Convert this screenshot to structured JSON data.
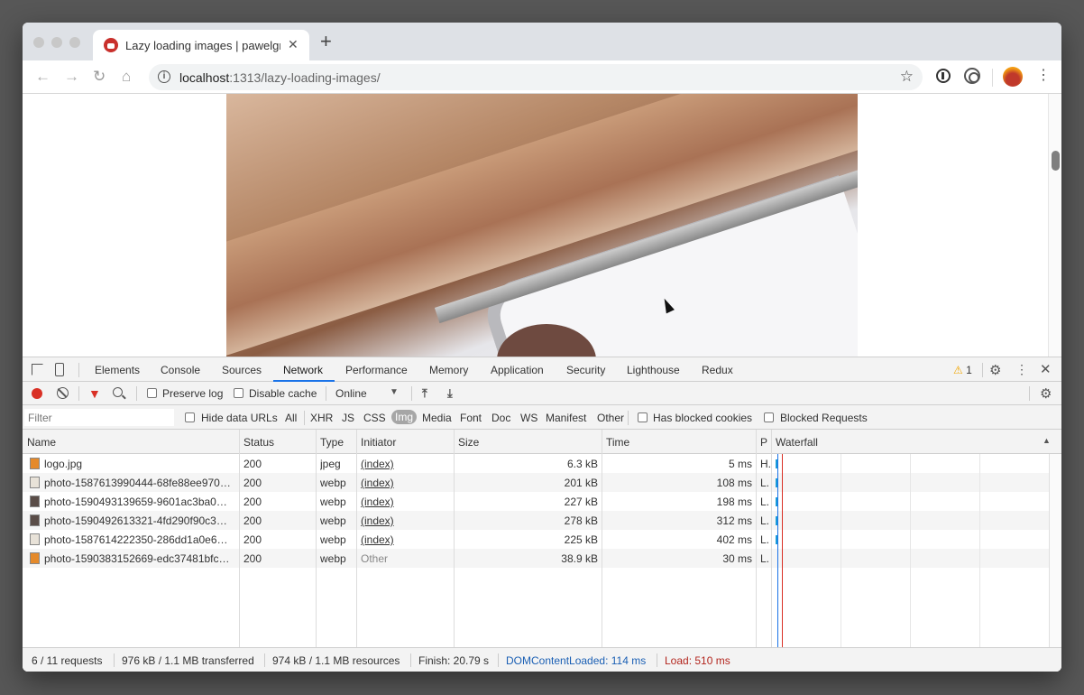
{
  "browser": {
    "tab_title": "Lazy loading images | pawelgrzybek.com",
    "tab_close": "✕",
    "new_tab": "+",
    "url_host": "localhost",
    "url_path": ":1313/lazy-loading-images/",
    "info_glyph": "i",
    "star_glyph": "☆",
    "back_glyph": "←",
    "forward_glyph": "→",
    "reload_glyph": "↻",
    "home_glyph": "⌂",
    "menu_glyph": "⋮"
  },
  "devtools": {
    "tabs": [
      "Elements",
      "Console",
      "Sources",
      "Network",
      "Performance",
      "Memory",
      "Application",
      "Security",
      "Lighthouse",
      "Redux"
    ],
    "active_tab": "Network",
    "warnings": "1",
    "warning_glyph": "⚠",
    "gear_glyph": "⚙",
    "more_glyph": "⋮",
    "close_glyph": "✕",
    "toolbar": {
      "preserve_log": "Preserve log",
      "disable_cache": "Disable cache",
      "throttling": "Online",
      "caret": "▼",
      "upload_glyph": "⤒",
      "download_glyph": "⤓",
      "filter_glyph": "▼"
    },
    "filter": {
      "placeholder": "Filter",
      "hide_data_urls": "Hide data URLs",
      "types": [
        "All",
        "XHR",
        "JS",
        "CSS",
        "Img",
        "Media",
        "Font",
        "Doc",
        "WS",
        "Manifest",
        "Other"
      ],
      "active_type": "Img",
      "has_blocked_cookies": "Has blocked cookies",
      "blocked_requests": "Blocked Requests"
    },
    "columns": {
      "name": "Name",
      "status": "Status",
      "type": "Type",
      "initiator": "Initiator",
      "size": "Size",
      "time": "Time",
      "priority": "P",
      "waterfall": "Waterfall",
      "sort_glyph": "▲"
    },
    "requests": [
      {
        "name": "logo.jpg",
        "status": "200",
        "type": "jpeg",
        "initiator": "(index)",
        "size": "6.3 kB",
        "time": "5 ms",
        "priority": "H."
      },
      {
        "name": "photo-1587613990444-68fe88ee970…",
        "status": "200",
        "type": "webp",
        "initiator": "(index)",
        "size": "201 kB",
        "time": "108 ms",
        "priority": "L."
      },
      {
        "name": "photo-1590493139659-9601ac3ba0…",
        "status": "200",
        "type": "webp",
        "initiator": "(index)",
        "size": "227 kB",
        "time": "198 ms",
        "priority": "L."
      },
      {
        "name": "photo-1590492613321-4fd290f90c3…",
        "status": "200",
        "type": "webp",
        "initiator": "(index)",
        "size": "278 kB",
        "time": "312 ms",
        "priority": "L."
      },
      {
        "name": "photo-1587614222350-286dd1a0e6…",
        "status": "200",
        "type": "webp",
        "initiator": "(index)",
        "size": "225 kB",
        "time": "402 ms",
        "priority": "L."
      },
      {
        "name": "photo-1590383152669-edc37481bfc…",
        "status": "200",
        "type": "webp",
        "initiator": "Other",
        "size": "38.9 kB",
        "time": "30 ms",
        "priority": "L."
      }
    ],
    "status_bar": {
      "requests": "6 / 11 requests",
      "transferred": "976 kB / 1.1 MB transferred",
      "resources": "974 kB / 1.1 MB resources",
      "finish": "Finish: 20.79 s",
      "dom_content_loaded": "DOMContentLoaded: 114 ms",
      "load": "Load: 510 ms"
    },
    "colors": {
      "record": "#d93025",
      "dom_content_loaded": "#1a5fb4",
      "load": "#b3261e",
      "waterfall_bar": "#1a9bd7"
    }
  }
}
